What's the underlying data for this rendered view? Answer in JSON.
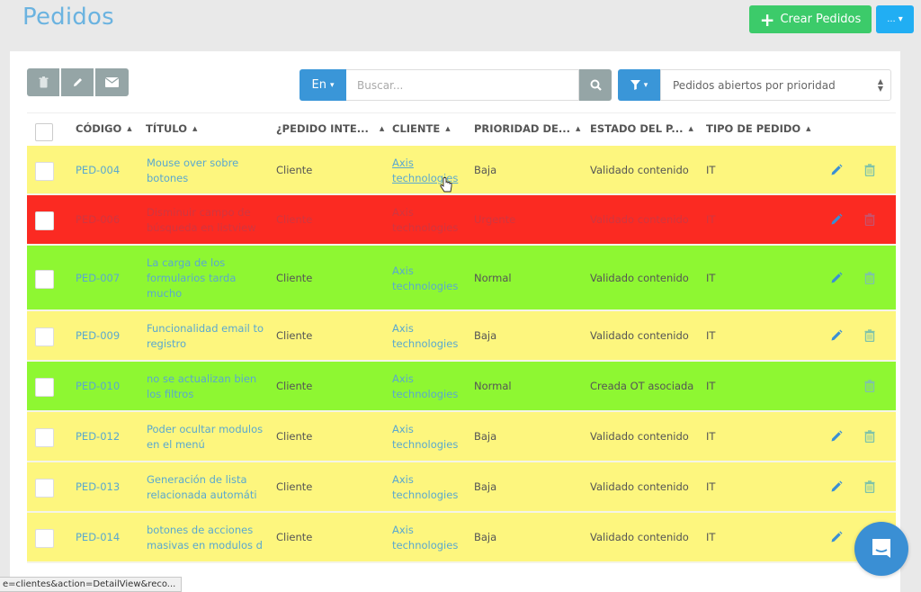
{
  "page": {
    "title": "Pedidos",
    "create_label": "Crear Pedidos",
    "more_label": "...",
    "accent_color": "#6bb3e0",
    "create_color": "#3ccb6a",
    "more_color": "#21aef3"
  },
  "toolbar": {
    "bulk_actions": [
      {
        "icon": "trash-icon"
      },
      {
        "icon": "pencil-icon"
      },
      {
        "icon": "envelope-icon"
      }
    ],
    "language_label": "En",
    "search_placeholder": "Buscar...",
    "search_value": "",
    "filter_selected": "Pedidos abiertos por prioridad"
  },
  "table": {
    "columns": [
      {
        "label": "CÓDIGO"
      },
      {
        "label": "TÍTULO"
      },
      {
        "label": "¿PEDIDO INTE..."
      },
      {
        "label": "CLIENTE"
      },
      {
        "label": "PRIORIDAD DE..."
      },
      {
        "label": "ESTADO DEL P..."
      },
      {
        "label": "TIPO DE PEDIDO"
      }
    ],
    "row_colors": {
      "yellow": "#fdf67e",
      "red": "#fb2a22",
      "green": "#8ef732"
    },
    "rows": [
      {
        "code": "PED-004",
        "title": "Mouse over sobre botones",
        "interno": "Cliente",
        "client": "Axis technologies",
        "priority": "Baja",
        "estado": "Validado contenido",
        "tipo": "IT",
        "color": "yellow",
        "editable": true
      },
      {
        "code": "PED-006",
        "title": "Disminuir campo de búsqueda en listview",
        "interno": "Cliente",
        "client": "Axis technologies",
        "priority": "Urgente",
        "estado": "Validado contenido",
        "tipo": "IT",
        "color": "red",
        "editable": true
      },
      {
        "code": "PED-007",
        "title": "La carga de los formularios tarda mucho",
        "interno": "Cliente",
        "client": "Axis technologies",
        "priority": "Normal",
        "estado": "Validado contenido",
        "tipo": "IT",
        "color": "green",
        "editable": true
      },
      {
        "code": "PED-009",
        "title": "Funcionalidad email to registro",
        "interno": "Cliente",
        "client": "Axis technologies",
        "priority": "Baja",
        "estado": "Validado contenido",
        "tipo": "IT",
        "color": "yellow",
        "editable": true
      },
      {
        "code": "PED-010",
        "title": "no se actualizan bien los filtros",
        "interno": "Cliente",
        "client": "Axis technologies",
        "priority": "Normal",
        "estado": "Creada OT asociada",
        "tipo": "IT",
        "color": "green",
        "editable": false
      },
      {
        "code": "PED-012",
        "title": "Poder ocultar modulos en el menú",
        "interno": "Cliente",
        "client": "Axis technologies",
        "priority": "Baja",
        "estado": "Validado contenido",
        "tipo": "IT",
        "color": "yellow",
        "editable": true
      },
      {
        "code": "PED-013",
        "title": "Generación de lista relacionada automáti",
        "interno": "Cliente",
        "client": "Axis technologies",
        "priority": "Baja",
        "estado": "Validado contenido",
        "tipo": "IT",
        "color": "yellow",
        "editable": true
      },
      {
        "code": "PED-014",
        "title": "botones de acciones masivas en modulos d",
        "interno": "Cliente",
        "client": "Axis technologies",
        "priority": "Baja",
        "estado": "Validado contenido",
        "tipo": "IT",
        "color": "yellow",
        "editable": true
      }
    ]
  },
  "status_bar": {
    "url": "e=clientes&action=DetailView&reco..."
  }
}
